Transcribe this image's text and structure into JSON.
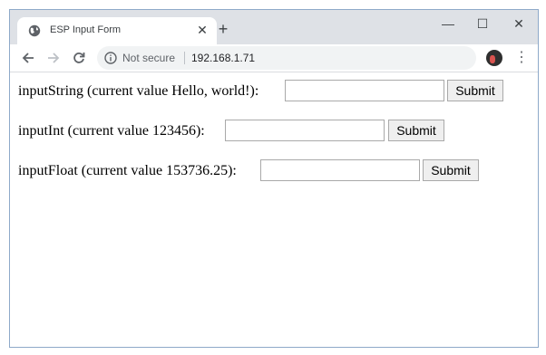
{
  "browser": {
    "tab": {
      "title": "ESP Input Form",
      "favicon_icon": "globe-icon",
      "close_glyph": "✕"
    },
    "new_tab_glyph": "+",
    "window_controls": {
      "minimize_glyph": "—",
      "maximize_glyph": "☐",
      "close_glyph": "✕"
    },
    "nav": {
      "back_icon": "back-arrow-icon",
      "forward_icon": "forward-arrow-icon",
      "reload_icon": "reload-icon"
    },
    "omnibox": {
      "security_text": "Not secure",
      "url": "192.168.1.71"
    },
    "menu_glyph": "⋮"
  },
  "form": {
    "rows": [
      {
        "label": "inputString (current value Hello, world!):",
        "value": "",
        "button": "Submit"
      },
      {
        "label": "inputInt (current value 123456):",
        "value": "",
        "button": "Submit"
      },
      {
        "label": "inputFloat (current value 153736.25):",
        "value": "",
        "button": "Submit"
      }
    ]
  }
}
